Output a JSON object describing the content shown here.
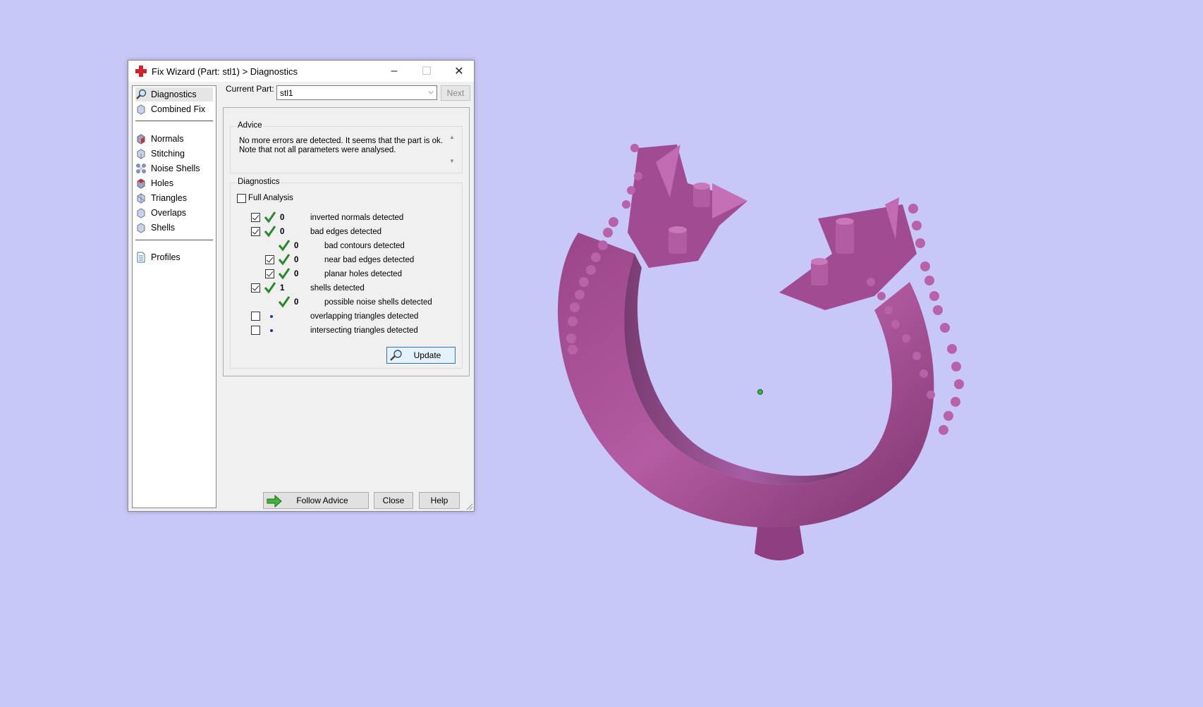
{
  "window": {
    "title": "Fix Wizard (Part: stl1) > Diagnostics",
    "minimize_glyph": "–",
    "maximize_glyph": "☐",
    "close_glyph": "✕"
  },
  "sidebar": {
    "items": [
      {
        "label": "Diagnostics",
        "icon": "magnifier-icon",
        "active": true
      },
      {
        "label": "Combined Fix",
        "icon": "cube-icon"
      },
      {
        "label": "Normals",
        "icon": "red-cube-icon"
      },
      {
        "label": "Stitching",
        "icon": "cube-icon"
      },
      {
        "label": "Noise Shells",
        "icon": "dots-cube-icon"
      },
      {
        "label": "Holes",
        "icon": "red-cube-icon"
      },
      {
        "label": "Triangles",
        "icon": "cube-icon"
      },
      {
        "label": "Overlaps",
        "icon": "cube-icon"
      },
      {
        "label": "Shells",
        "icon": "cube-icon"
      },
      {
        "label": "Profiles",
        "icon": "document-icon"
      }
    ]
  },
  "current_part": {
    "label": "Current Part:",
    "value": "stl1",
    "next_label": "Next"
  },
  "advice": {
    "title": "Advice",
    "line1": "No more errors are detected. It seems that the part is ok.",
    "line2": "Note that not all parameters were analysed."
  },
  "diagnostics": {
    "title": "Diagnostics",
    "full_analysis_label": "Full Analysis",
    "rows": [
      {
        "checked": true,
        "status": "ok",
        "count": "0",
        "label": "inverted normals detected"
      },
      {
        "checked": true,
        "status": "ok",
        "count": "0",
        "label": "bad edges detected"
      },
      {
        "checked": null,
        "status": "ok",
        "count": "0",
        "label": "bad contours detected"
      },
      {
        "checked": true,
        "status": "ok",
        "count": "0",
        "label": "near bad edges detected"
      },
      {
        "checked": true,
        "status": "ok",
        "count": "0",
        "label": "planar holes detected"
      },
      {
        "checked": true,
        "status": "ok",
        "count": "1",
        "label": "shells detected"
      },
      {
        "checked": null,
        "status": "ok",
        "count": "0",
        "label": "possible noise shells detected"
      },
      {
        "checked": false,
        "status": "not-run",
        "count": "",
        "label": "overlapping triangles detected"
      },
      {
        "checked": false,
        "status": "not-run",
        "count": "",
        "label": "intersecting triangles detected"
      }
    ],
    "update_label": "Update"
  },
  "footer": {
    "follow_advice_label": "Follow Advice",
    "close_label": "Close",
    "help_label": "Help"
  },
  "colors": {
    "background": "#c8c8f8",
    "model": "#a84f96",
    "check_green": "#2a8a2a"
  }
}
